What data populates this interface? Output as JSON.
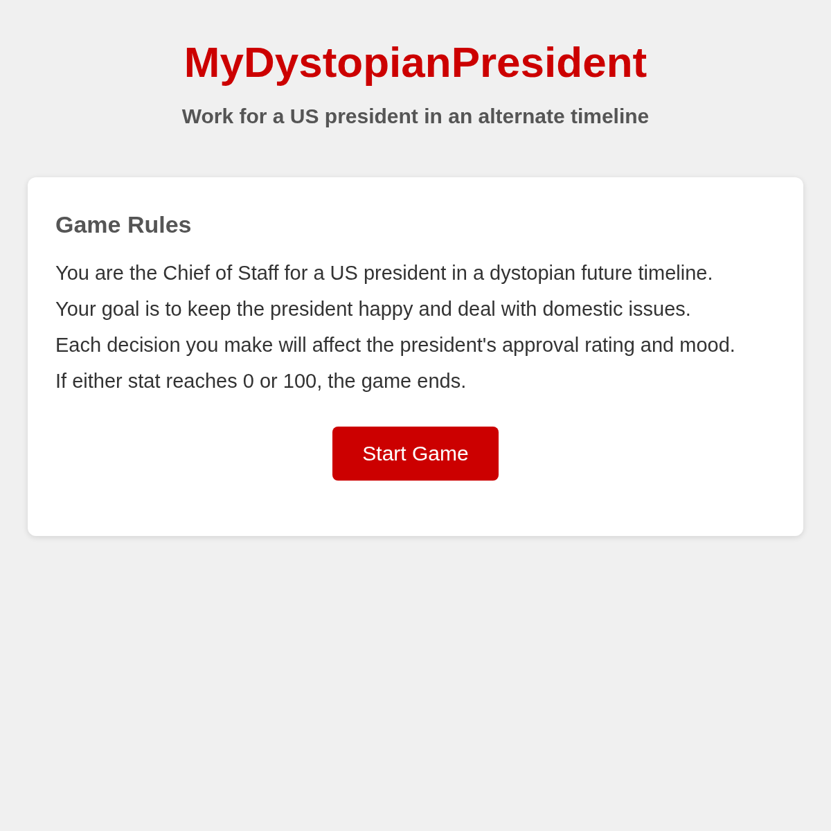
{
  "header": {
    "title": "MyDystopianPresident",
    "subtitle": "Work for a US president in an alternate timeline"
  },
  "rules_card": {
    "heading": "Game Rules",
    "lines": [
      "You are the Chief of Staff for a US president in a dystopian future timeline.",
      "Your goal is to keep the president happy and deal with domestic issues.",
      "Each decision you make will affect the president's approval rating and mood.",
      "If either stat reaches 0 or 100, the game ends."
    ],
    "button": "Start Game"
  }
}
